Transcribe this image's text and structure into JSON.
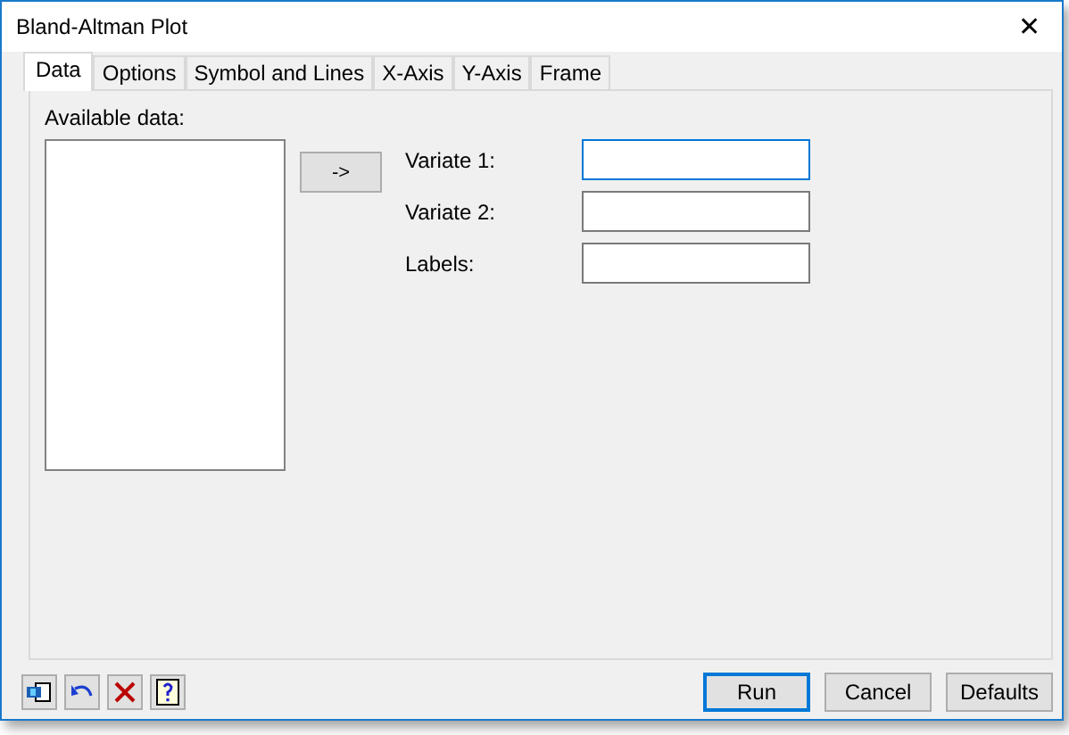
{
  "window": {
    "title": "Bland-Altman Plot",
    "close": "✕"
  },
  "tabs": [
    {
      "label": "Data",
      "selected": true
    },
    {
      "label": "Options",
      "selected": false
    },
    {
      "label": "Symbol and Lines",
      "selected": false
    },
    {
      "label": "X-Axis",
      "selected": false
    },
    {
      "label": "Y-Axis",
      "selected": false
    },
    {
      "label": "Frame",
      "selected": false
    }
  ],
  "available_data": {
    "label": "Available data:"
  },
  "move_button": "->",
  "fields": [
    {
      "label": "Variate 1:",
      "focused": true
    },
    {
      "label": "Variate 2:",
      "focused": false
    },
    {
      "label": "Labels:",
      "focused": false
    }
  ],
  "toolbar": [
    {
      "kind": "import"
    },
    {
      "kind": "undo"
    },
    {
      "kind": "clear"
    },
    {
      "kind": "help"
    }
  ],
  "buttons": [
    {
      "label": "Run",
      "default": true
    },
    {
      "label": "Cancel",
      "default": false
    },
    {
      "label": "Defaults",
      "default": false
    }
  ]
}
